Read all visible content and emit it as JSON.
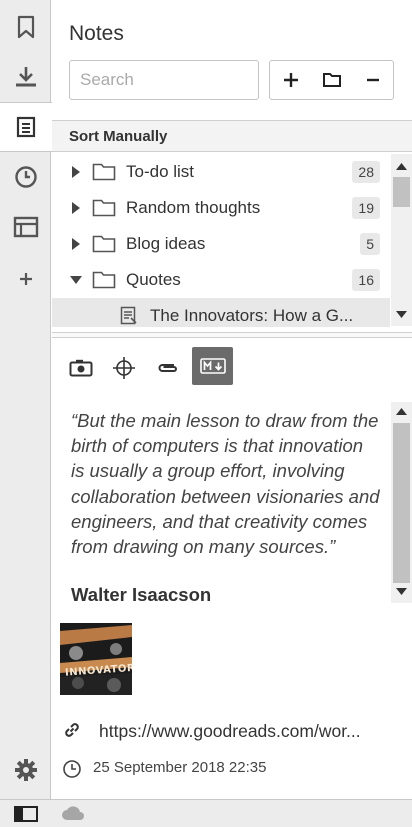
{
  "rail": {
    "items": [
      {
        "icon": "bookmark-icon"
      },
      {
        "icon": "download-icon"
      },
      {
        "icon": "notes-icon",
        "active": true
      },
      {
        "icon": "history-clock-icon"
      },
      {
        "icon": "window-icon"
      },
      {
        "icon": "add-panel-icon"
      },
      {
        "icon": "settings-gear-icon"
      }
    ]
  },
  "notes": {
    "title": "Notes",
    "search_placeholder": "Search",
    "toolbar": [
      {
        "icon": "add-icon"
      },
      {
        "icon": "folder-icon"
      },
      {
        "icon": "remove-icon"
      }
    ],
    "sort_label": "Sort Manually",
    "folders": [
      {
        "label": "To-do list",
        "count": "28",
        "expanded": false
      },
      {
        "label": "Random thoughts",
        "count": "19",
        "expanded": false
      },
      {
        "label": "Blog ideas",
        "count": "5",
        "expanded": false
      },
      {
        "label": "Quotes",
        "count": "16",
        "expanded": true
      }
    ],
    "selected_note": {
      "label": "The Innovators: How a G..."
    }
  },
  "editor": {
    "tools": [
      {
        "icon": "camera-icon"
      },
      {
        "icon": "crosshair-icon"
      },
      {
        "icon": "paperclip-icon"
      },
      {
        "icon": "markdown-icon",
        "active": true
      }
    ],
    "quote": "“But the main lesson to draw from the birth of computers is that innovation is usually a group effort, involving collaboration between visionaries and engineers, and that creativity comes from drawing on many sources.”",
    "author": "Walter Isaacson",
    "cover_title": "INNOVATORS",
    "link": "https://www.goodreads.com/wor...",
    "date": "25 September 2018 22:35"
  },
  "status_bar": {
    "items": [
      {
        "icon": "panel-toggle-icon"
      },
      {
        "icon": "cloud-sync-icon"
      }
    ]
  }
}
